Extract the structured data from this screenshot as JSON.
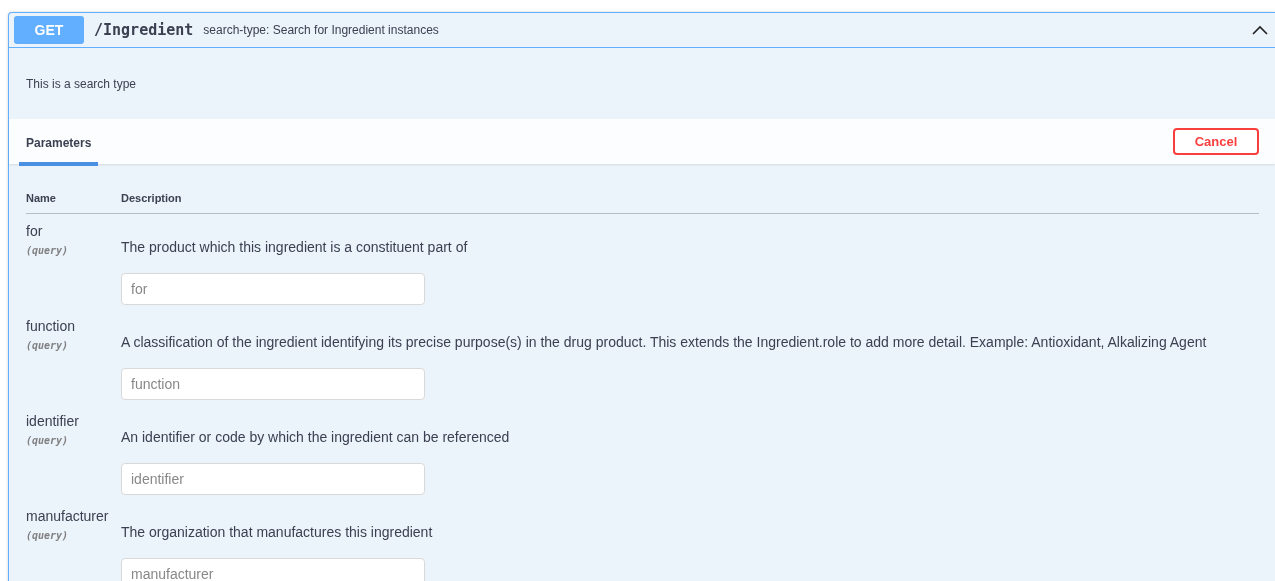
{
  "operation": {
    "method": "GET",
    "path": "/Ingredient",
    "summary": "search-type: Search for Ingredient instances",
    "expanded": true
  },
  "description": "This is a search type",
  "tabs": [
    {
      "label": "Parameters",
      "selected": true
    }
  ],
  "cancel_button": "Cancel",
  "table": {
    "columns": [
      "Name",
      "Description"
    ],
    "rows": [
      {
        "name": "for",
        "location": "(query)",
        "description": "The product which this ingredient is a constituent part of",
        "placeholder": "for"
      },
      {
        "name": "function",
        "location": "(query)",
        "description": "A classification of the ingredient identifying its precise purpose(s) in the drug product. This extends the Ingredient.role to add more detail. Example: Antioxidant, Alkalizing Agent",
        "placeholder": "function"
      },
      {
        "name": "identifier",
        "location": "(query)",
        "description": "An identifier or code by which the ingredient can be referenced",
        "placeholder": "identifier"
      },
      {
        "name": "manufacturer",
        "location": "(query)",
        "description": "The organization that manufactures this ingredient",
        "placeholder": "manufacturer"
      }
    ]
  }
}
